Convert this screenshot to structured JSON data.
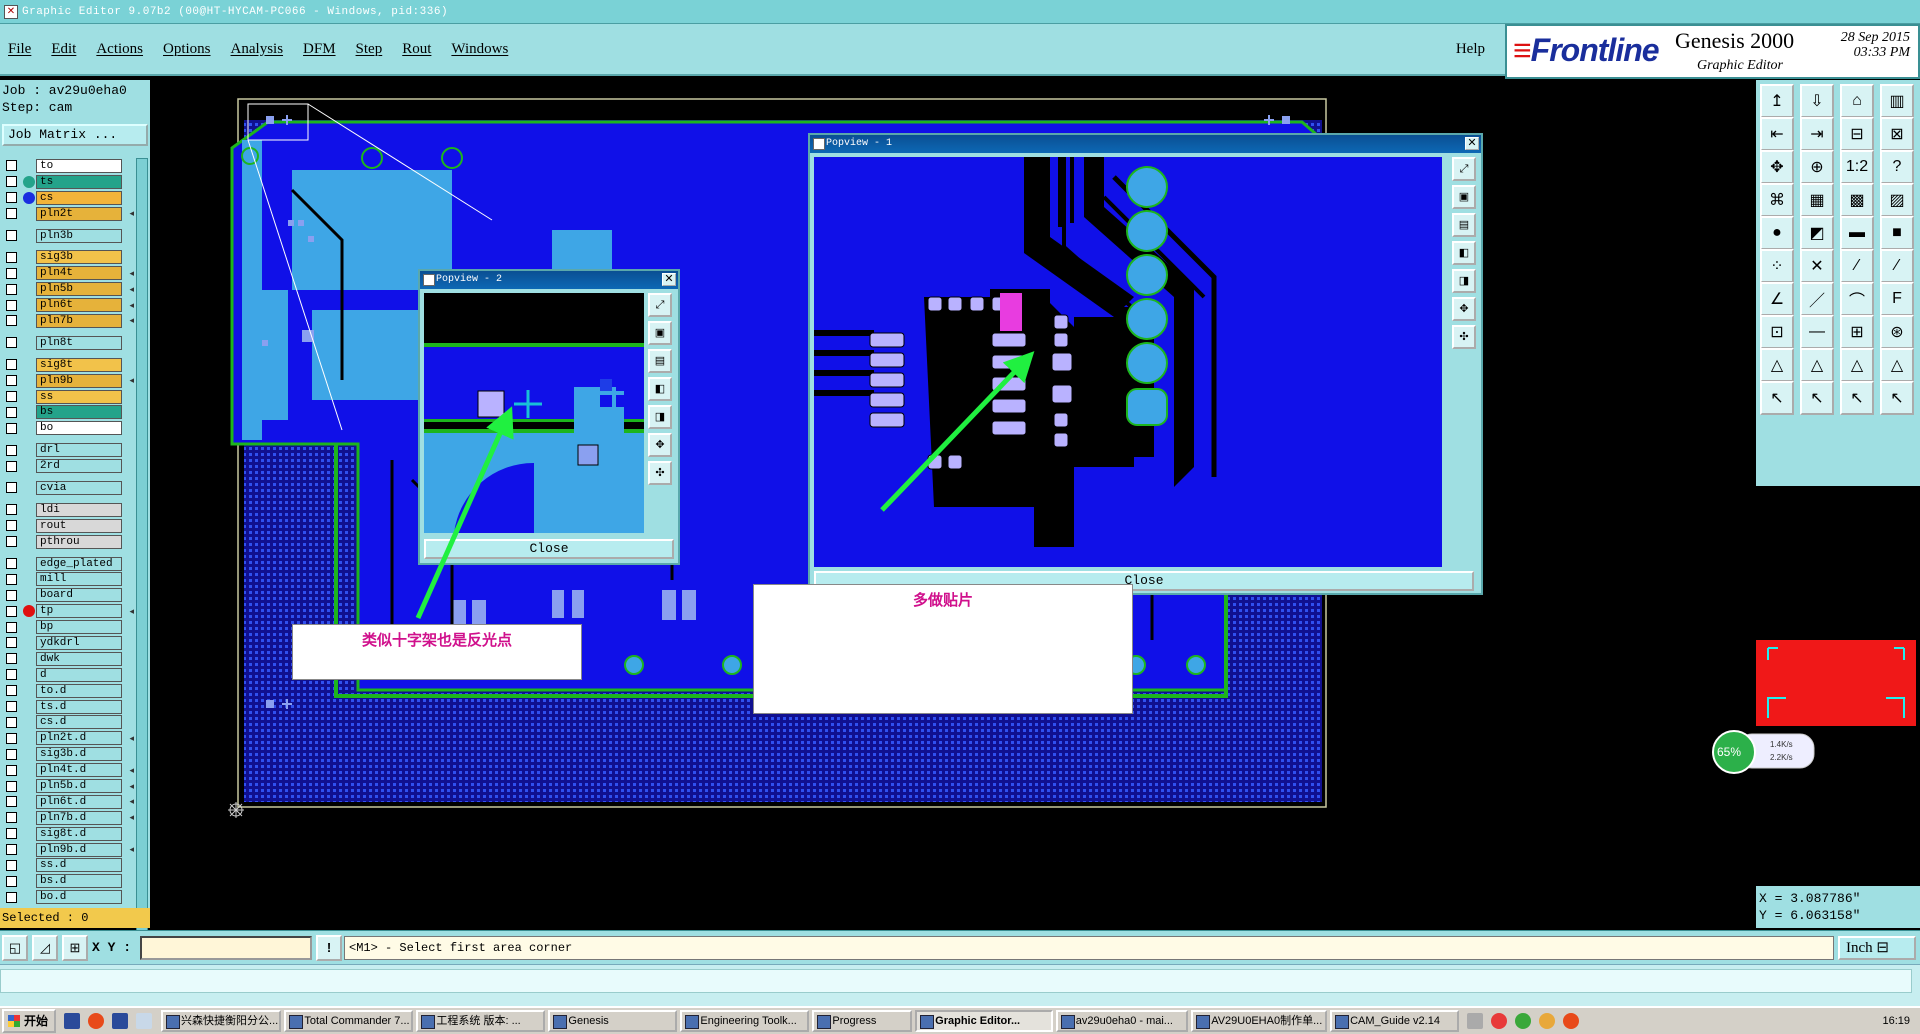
{
  "window": {
    "title": "Graphic Editor 9.07b2 (00@HT-HYCAM-PC066 - Windows, pid:336)"
  },
  "menu": [
    "File",
    "Edit",
    "Actions",
    "Options",
    "Analysis",
    "DFM",
    "Step",
    "Rout",
    "Windows"
  ],
  "help_label": "Help",
  "brand": {
    "logo": "Frontline",
    "product": "Genesis 2000",
    "subtitle": "Graphic Editor",
    "date": "28 Sep 2015",
    "time": "03:33 PM"
  },
  "job": {
    "job_line": "Job : av29u0eha0",
    "step_line": "Step: cam",
    "matrix_button": "Job Matrix ..."
  },
  "layers": [
    {
      "name": "to",
      "color": "#ffffff"
    },
    {
      "name": "ts",
      "color": "#24a38a",
      "dot": "#24a38a"
    },
    {
      "name": "cs",
      "color": "#f2b43a",
      "dot": "#1a2ee0"
    },
    {
      "name": "pln2t",
      "color": "#e6b23a",
      "star": true
    },
    {
      "name": "pln3b",
      "color": "#9fdfe2",
      "gap": true
    },
    {
      "name": "sig3b",
      "color": "#f2c24a",
      "gap": true
    },
    {
      "name": "pln4t",
      "color": "#e6b23a",
      "star": true
    },
    {
      "name": "pln5b",
      "color": "#e6b23a",
      "star": true
    },
    {
      "name": "pln6t",
      "color": "#e6b23a",
      "star": true
    },
    {
      "name": "pln7b",
      "color": "#e6b23a",
      "star": true
    },
    {
      "name": "pln8t",
      "color": "#9fdfe2",
      "gap": true
    },
    {
      "name": "sig8t",
      "color": "#f2c24a",
      "gap": true
    },
    {
      "name": "pln9b",
      "color": "#e6b23a",
      "star": true
    },
    {
      "name": "ss",
      "color": "#f2c24a"
    },
    {
      "name": "bs",
      "color": "#24a38a"
    },
    {
      "name": "bo",
      "color": "#ffffff"
    },
    {
      "name": "drl",
      "color": "#9fdfe2",
      "gap": true
    },
    {
      "name": "2rd",
      "color": "#9fdfe2"
    },
    {
      "name": "cvia",
      "color": "#9fdfe2",
      "gap": true
    },
    {
      "name": "ldi",
      "color": "#d8d8d8",
      "gap": true
    },
    {
      "name": "rout",
      "color": "#d8d8d8"
    },
    {
      "name": "pthrou",
      "color": "#d8d8d8"
    },
    {
      "name": "edge_plated",
      "color": "#9fdfe2",
      "gap": true
    },
    {
      "name": "mill",
      "color": "#9fdfe2"
    },
    {
      "name": "board",
      "color": "#9fdfe2"
    },
    {
      "name": "tp",
      "color": "#9fdfe2",
      "dot": "#e01010",
      "star": true
    },
    {
      "name": "bp",
      "color": "#9fdfe2"
    },
    {
      "name": "ydkdrl",
      "color": "#9fdfe2"
    },
    {
      "name": "dwk",
      "color": "#9fdfe2"
    },
    {
      "name": "d",
      "color": "#9fdfe2"
    },
    {
      "name": "to.d",
      "color": "#9fdfe2"
    },
    {
      "name": "ts.d",
      "color": "#9fdfe2"
    },
    {
      "name": "cs.d",
      "color": "#9fdfe2"
    },
    {
      "name": "pln2t.d",
      "color": "#9fdfe2",
      "star": true
    },
    {
      "name": "sig3b.d",
      "color": "#9fdfe2"
    },
    {
      "name": "pln4t.d",
      "color": "#9fdfe2",
      "star": true
    },
    {
      "name": "pln5b.d",
      "color": "#9fdfe2",
      "star": true
    },
    {
      "name": "pln6t.d",
      "color": "#9fdfe2",
      "star": true
    },
    {
      "name": "pln7b.d",
      "color": "#9fdfe2",
      "star": true
    },
    {
      "name": "sig8t.d",
      "color": "#9fdfe2"
    },
    {
      "name": "pln9b.d",
      "color": "#9fdfe2",
      "star": true
    },
    {
      "name": "ss.d",
      "color": "#9fdfe2"
    },
    {
      "name": "bs.d",
      "color": "#9fdfe2"
    },
    {
      "name": "bo.d",
      "color": "#9fdfe2"
    }
  ],
  "selected": "Selected : 0",
  "popview1": {
    "title": "Popview - 1",
    "close": "Close"
  },
  "popview2": {
    "title": "Popview - 2",
    "close": "Close"
  },
  "notes": {
    "left": "类似十字架也是反光点",
    "center": "多做贴片"
  },
  "coordinates": {
    "x": "X = 3.087786\"",
    "y": "Y = 6.063158\""
  },
  "netmon": {
    "percent": "65%",
    "up": "1.4K/s",
    "down": "2.2K/s"
  },
  "cmd": {
    "xy_label": "X Y :",
    "xy_value": "",
    "status": "<M1> - Select first area corner",
    "unit": "Inch"
  },
  "taskbar": {
    "start": "开始",
    "items": [
      {
        "label": "兴森快捷衡阳分公...",
        "active": false
      },
      {
        "label": "Total Commander 7...",
        "active": false
      },
      {
        "label": "工程系统    版本: ...",
        "active": false
      },
      {
        "label": "Genesis",
        "active": false
      },
      {
        "label": "Engineering Toolk...",
        "active": false
      },
      {
        "label": "Progress",
        "active": false
      },
      {
        "label": "Graphic Editor...",
        "active": true
      },
      {
        "label": "av29u0eha0 - mai...",
        "active": false
      },
      {
        "label": "AV29U0EHA0制作单...",
        "active": false
      },
      {
        "label": "CAM_Guide v2.14",
        "active": false
      }
    ],
    "clock": "16:19"
  },
  "colors": {
    "panel": "#9fdfe2",
    "board_blue": "#1010e8",
    "copper_light": "#3ea6e6",
    "green": "#1db51d",
    "highlight": "#e83ce0"
  }
}
